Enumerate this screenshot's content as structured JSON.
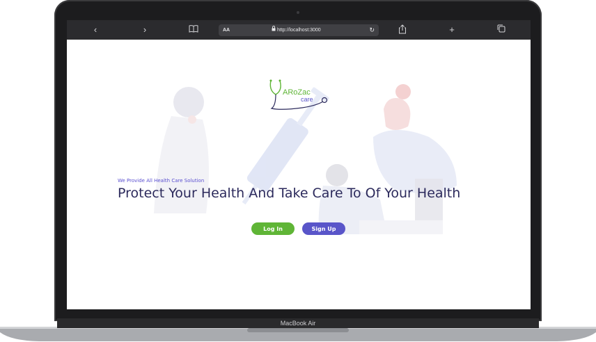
{
  "device": {
    "label": "MacBook Air"
  },
  "browser": {
    "aa_label": "AA",
    "address": "http://localhost:3000",
    "icons": [
      "back-icon",
      "forward-icon",
      "bookmarks-icon",
      "lock-icon",
      "reload-icon",
      "share-icon",
      "new-tab-icon",
      "tabs-icon"
    ]
  },
  "logo": {
    "line1": "ARoZac",
    "line2": "care"
  },
  "hero": {
    "tagline": "We Provide All Health Care Solution",
    "headline": "Protect Your Health And Take Care To Of Your Health",
    "login_label": "Log In",
    "signup_label": "Sign Up"
  },
  "colors": {
    "accent_green": "#5fb536",
    "accent_purple": "#5955c9",
    "headline": "#2c2a5c"
  }
}
